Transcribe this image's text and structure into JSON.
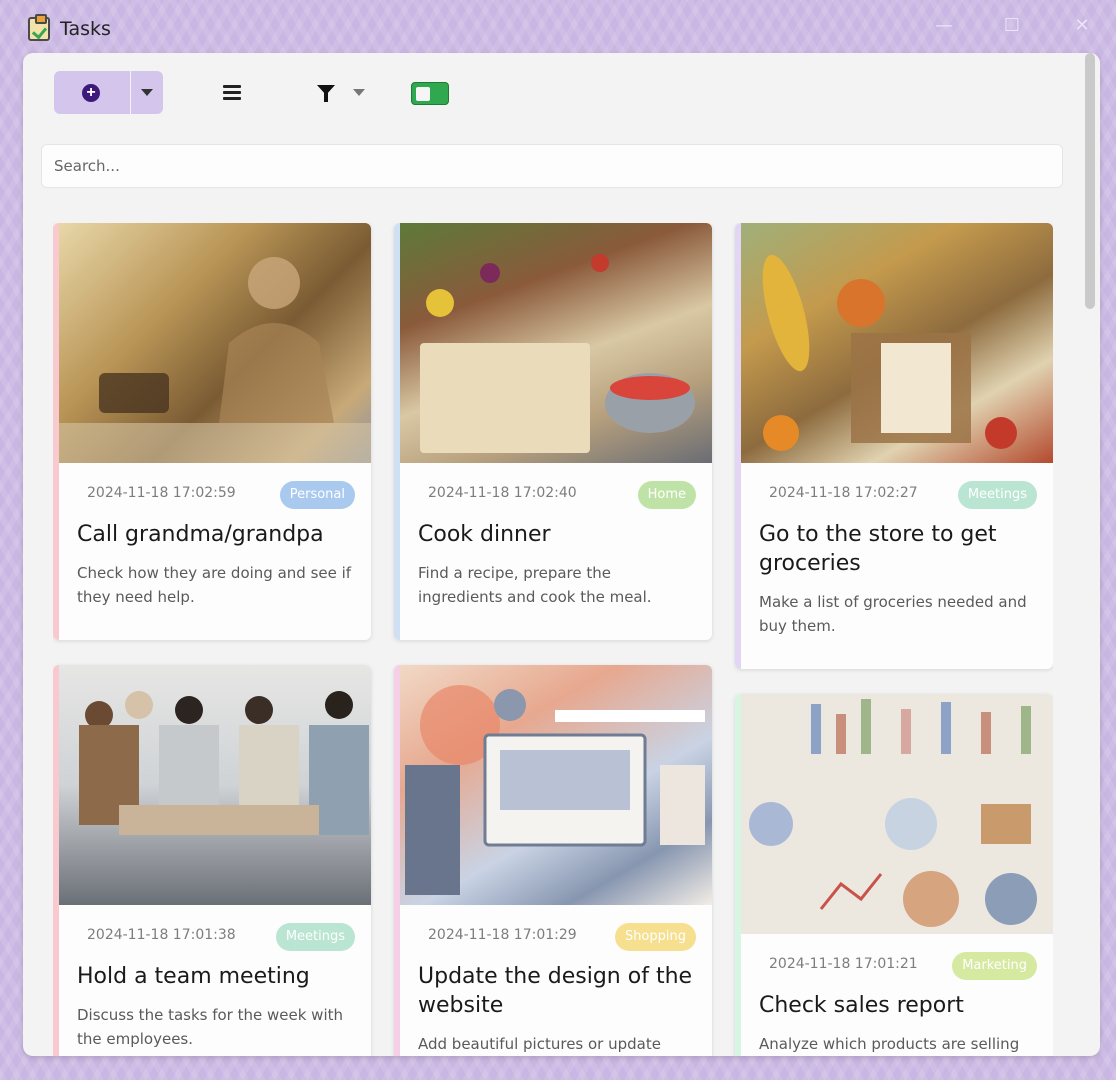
{
  "window": {
    "title": "Tasks"
  },
  "toolbar": {
    "add_label": "+"
  },
  "search": {
    "placeholder": "Search..."
  },
  "cards": [
    {
      "date": "2024-11-18 17:02:59",
      "tag": "Personal",
      "tag_color": "#a9c9ef",
      "accent": "#f8c9cf",
      "title": "Call grandma/grandpa",
      "desc": "Check how they are doing and see if they need help.",
      "image": "person-on-phone-illustration"
    },
    {
      "date": "2024-11-18 17:02:40",
      "tag": "Home",
      "tag_color": "#bfe3a7",
      "accent": "#cfe0f5",
      "title": "Cook dinner",
      "desc": "Find a recipe, prepare the ingredients and cook the meal.",
      "image": "cooking-illustration"
    },
    {
      "date": "2024-11-18 17:02:27",
      "tag": "Meetings",
      "tag_color": "#b9e5d2",
      "accent": "#e3d6f5",
      "title": "Go to the store to get groceries",
      "desc": "Make a list of groceries needed and buy them.",
      "image": "groceries-illustration"
    },
    {
      "date": "2024-11-18 17:01:38",
      "tag": "Meetings",
      "tag_color": "#b9e5d2",
      "accent": "#f8c9cf",
      "title": "Hold a team meeting",
      "desc": "Discuss the tasks for the week with the employees.",
      "image": "team-meeting-illustration"
    },
    {
      "date": "2024-11-18 17:01:29",
      "tag": "Shopping",
      "tag_color": "#f6df8f",
      "accent": "#f5cfe5",
      "title": "Update the design of the website",
      "desc": "Add beautiful pictures or update",
      "image": "web-design-illustration"
    },
    {
      "date": "2024-11-18 17:01:21",
      "tag": "Marketing",
      "tag_color": "#d5e9a1",
      "accent": "#d6f5e3",
      "title": "Check sales report",
      "desc": "Analyze which products are selling",
      "image": "sales-report-illustration"
    }
  ]
}
